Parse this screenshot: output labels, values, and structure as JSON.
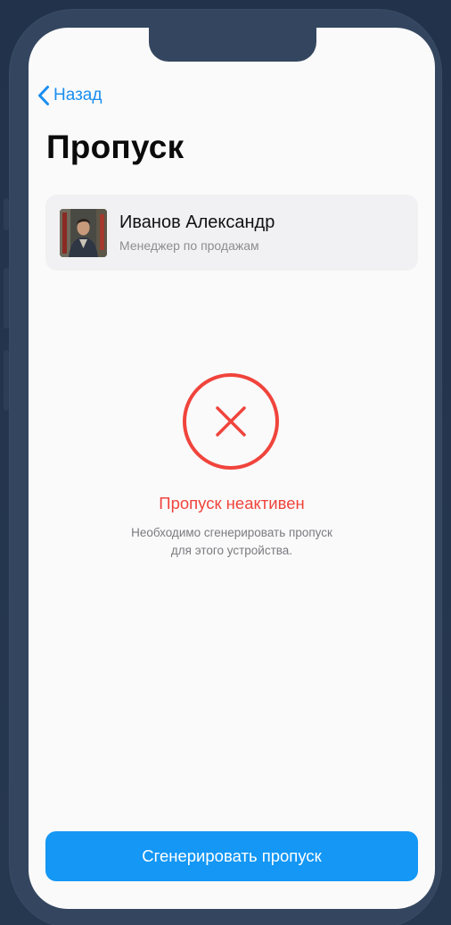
{
  "nav": {
    "back_label": "Назад"
  },
  "page": {
    "title": "Пропуск"
  },
  "profile": {
    "name": "Иванов Александр",
    "role": "Менеджер по продажам"
  },
  "status": {
    "icon": "x-circle-icon",
    "title": "Пропуск неактивен",
    "description_line1": "Необходимо сгенерировать пропуск",
    "description_line2": "для этого устройства."
  },
  "actions": {
    "generate_label": "Сгенерировать пропуск"
  },
  "colors": {
    "accent": "#1497f5",
    "error": "#f0443c",
    "background": "#fafafa",
    "card": "#f1f1f3",
    "frame": "#34465f"
  }
}
